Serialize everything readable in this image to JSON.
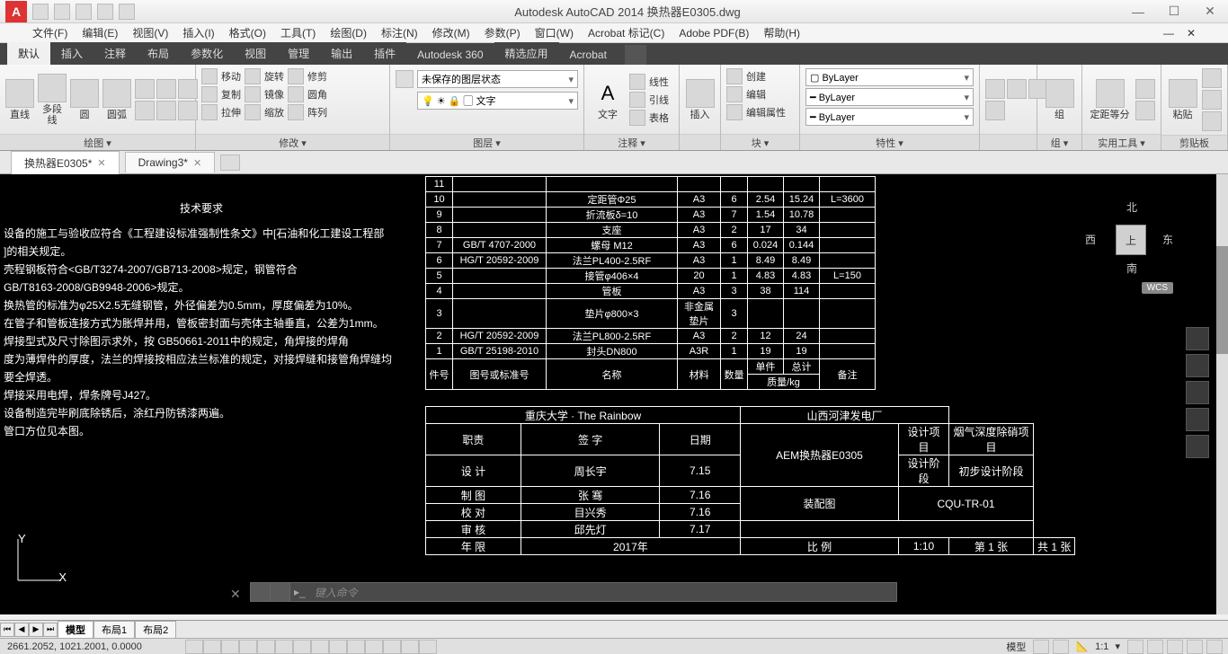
{
  "app": {
    "title": "Autodesk AutoCAD 2014    换热器E0305.dwg"
  },
  "menus": [
    "文件(F)",
    "编辑(E)",
    "视图(V)",
    "插入(I)",
    "格式(O)",
    "工具(T)",
    "绘图(D)",
    "标注(N)",
    "修改(M)",
    "参数(P)",
    "窗口(W)",
    "Acrobat 标记(C)",
    "Adobe PDF(B)",
    "帮助(H)"
  ],
  "ribbontabs": [
    "默认",
    "插入",
    "注释",
    "布局",
    "参数化",
    "视图",
    "管理",
    "输出",
    "插件",
    "Autodesk 360",
    "精选应用",
    "Acrobat"
  ],
  "panels": {
    "draw": {
      "label": "绘图 ▾",
      "btns": [
        "直线",
        "多段线",
        "圆",
        "圆弧"
      ]
    },
    "modify": {
      "label": "修改 ▾",
      "rows": [
        [
          "移动",
          "旋转",
          "修剪"
        ],
        [
          "复制",
          "镜像",
          "圆角"
        ],
        [
          "拉伸",
          "缩放",
          "阵列"
        ]
      ]
    },
    "layer": {
      "label": "图层 ▾",
      "state": "未保存的图层状态",
      "layer": "文字"
    },
    "annot": {
      "label": "注释 ▾",
      "text": "文字",
      "rows": [
        "线性",
        "引线",
        "表格"
      ]
    },
    "insert": {
      "label": "插入"
    },
    "block": {
      "label": "块 ▾",
      "rows": [
        "创建",
        "编辑",
        "编辑属性"
      ]
    },
    "props": {
      "label": "特性 ▾",
      "vals": [
        "ByLayer",
        "ByLayer",
        "ByLayer"
      ]
    },
    "group": {
      "label": "组 ▾",
      "btn": "组"
    },
    "util": {
      "label": "实用工具 ▾",
      "btn": "定距等分"
    },
    "clip": {
      "label": "剪贴板",
      "btn": "粘贴"
    }
  },
  "doctabs": [
    {
      "name": "换热器E0305*",
      "active": true
    },
    {
      "name": "Drawing3*",
      "active": false
    }
  ],
  "req": {
    "title": "技术要求",
    "lines": [
      "设备的施工与验收应符合《工程建设标准强制性条文》中[石油和化工建设工程部",
      "]的相关规定。",
      "壳程钢板符合<GB/T3274-2007/GB713-2008>规定，钢管符合",
      "GB/T8163-2008/GB9948-2006>规定。",
      "换热管的标准为φ25X2.5无缝钢管，外径偏差为0.5mm，厚度偏差为10%。",
      "在管子和管板连接方式为胀焊并用，管板密封面与壳体主轴垂直，公差为1mm。",
      "焊接型式及尺寸除图示求外，按 GB50661-2011中的规定，角焊接的焊角",
      "度为薄焊件的厚度，法兰的焊接按相应法兰标准的规定，对接焊缝和接管角焊缝均",
      "要全焊透。",
      "焊接采用电焊，焊条牌号J427。",
      "设备制造完毕刷底除锈后，涂红丹防锈漆两遍。",
      "管口方位见本图。"
    ]
  },
  "parts": {
    "headers": [
      "件号",
      "图号或标准号",
      "名称",
      "材料",
      "数量",
      "单件",
      "总计",
      "备注"
    ],
    "sub": "质量/kg",
    "rows": [
      [
        "11",
        "",
        "",
        "",
        "",
        "",
        "",
        ""
      ],
      [
        "10",
        "",
        "定距管Φ25",
        "A3",
        "6",
        "2.54",
        "15.24",
        "L=3600"
      ],
      [
        "9",
        "",
        "折流板δ=10",
        "A3",
        "7",
        "1.54",
        "10.78",
        ""
      ],
      [
        "8",
        "",
        "支座",
        "A3",
        "2",
        "17",
        "34",
        ""
      ],
      [
        "7",
        "GB/T 4707-2000",
        "螺母 M12",
        "A3",
        "6",
        "0.024",
        "0.144",
        ""
      ],
      [
        "6",
        "HG/T 20592-2009",
        "法兰PL400-2.5RF",
        "A3",
        "1",
        "8.49",
        "8.49",
        ""
      ],
      [
        "5",
        "",
        "接管φ406×4",
        "20",
        "1",
        "4.83",
        "4.83",
        "L=150"
      ],
      [
        "4",
        "",
        "管板",
        "A3",
        "3",
        "38",
        "114",
        ""
      ],
      [
        "3",
        "",
        "垫片φ800×3",
        "非金属垫片",
        "3",
        "",
        "",
        ""
      ],
      [
        "2",
        "HG/T 20592-2009",
        "法兰PL800-2.5RF",
        "A3",
        "2",
        "12",
        "24",
        ""
      ],
      [
        "1",
        "GB/T 25198-2010",
        "封头DN800",
        "A3R",
        "1",
        "19",
        "19",
        ""
      ]
    ]
  },
  "tblock": {
    "univ": "重庆大学 · The Rainbow",
    "company": "山西河津发电厂",
    "title": "AEM换热器E0305",
    "sub": "装配图",
    "code": "CQU-TR-01",
    "cols": [
      "职责",
      "签 字",
      "日期"
    ],
    "rows": [
      [
        "设 计",
        "周长宇",
        "7.15"
      ],
      [
        "制 图",
        "张 骞",
        "7.16"
      ],
      [
        "校 对",
        "目兴秀",
        "7.16"
      ],
      [
        "审 核",
        "邱先灯",
        "7.17"
      ]
    ],
    "year_l": "年 限",
    "year_v": "2017年",
    "scale_l": "比 例",
    "scale_v": "1:10",
    "sheet_l": "第 1 张",
    "sheet_r": "共 1 张",
    "proj_l": "设计项目",
    "proj_v": "烟气深度除硝项目",
    "stage_l": "设计阶段",
    "stage_v": "初步设计阶段"
  },
  "viewcube": {
    "top": "上",
    "n": "北",
    "s": "南",
    "e": "东",
    "w": "西",
    "wcs": "WCS"
  },
  "cmd": {
    "prompt": "键入命令"
  },
  "layouts": [
    "模型",
    "布局1",
    "布局2"
  ],
  "status": {
    "coords": "2661.2052, 1021.2001, 0.0000",
    "model": "模型",
    "scale": "1:1"
  }
}
